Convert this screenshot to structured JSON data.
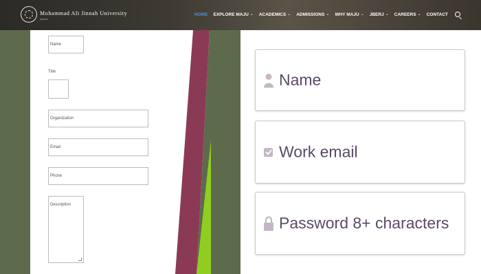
{
  "header": {
    "university_name": "Mohammad Ali Jinnah University",
    "university_sub": "Karachi",
    "nav": [
      {
        "label": "HOME",
        "active": true,
        "dropdown": false
      },
      {
        "label": "EXPLORE MAJU",
        "active": false,
        "dropdown": true
      },
      {
        "label": "ACADEMICS",
        "active": false,
        "dropdown": true
      },
      {
        "label": "ADMISSIONS",
        "active": false,
        "dropdown": true
      },
      {
        "label": "WHY MAJU",
        "active": false,
        "dropdown": true
      },
      {
        "label": "JBERJ",
        "active": false,
        "dropdown": true
      },
      {
        "label": "CAREERS",
        "active": false,
        "dropdown": true
      },
      {
        "label": "CONTACT",
        "active": false,
        "dropdown": false
      }
    ],
    "search_icon": "search-icon",
    "active_color": "#4a90e2"
  },
  "left_form": {
    "name_label": "Name",
    "title_label": "Title",
    "organization_label": "Organization",
    "email_label": "Email",
    "phone_label": "Phone",
    "description_label": "Description"
  },
  "right_form": {
    "name_placeholder": "Name",
    "email_placeholder": "Work email",
    "password_placeholder": "Password 8+ characters",
    "icons": [
      "person-icon",
      "checkbox-icon",
      "lock-icon"
    ]
  },
  "colors": {
    "olive": "#5e6a4c",
    "maroon": "#8b3a55",
    "lime": "#8fce1e",
    "placeholder": "#5a4a66"
  }
}
